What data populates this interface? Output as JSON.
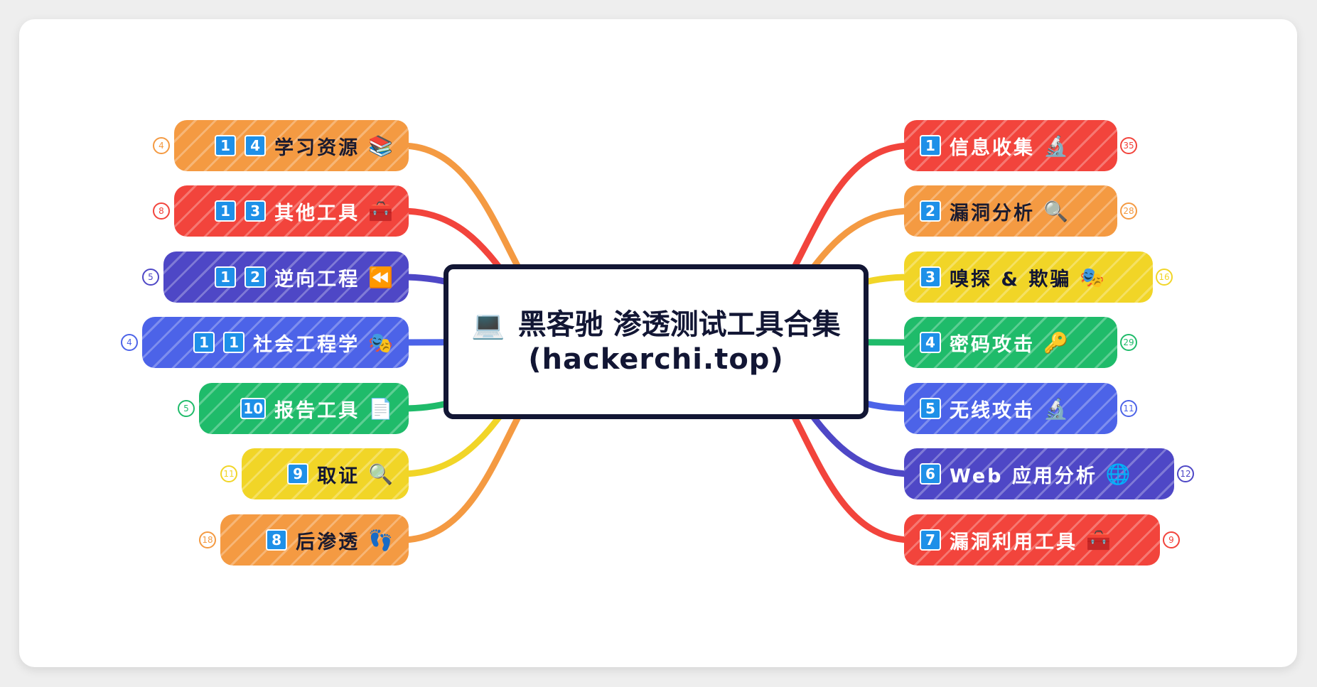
{
  "center": {
    "icon": "💻",
    "title": "黑客驰 渗透测试工具合集",
    "subtitle": "(hackerchi.top)"
  },
  "colors": {
    "red": "#f2443c",
    "orange": "#f49a42",
    "yellow": "#f1d527",
    "green": "#1fbb6a",
    "blue": "#4c63e8",
    "indigo": "#4e47c6",
    "dark": "#121634",
    "badge": "#1e90e8"
  },
  "right_branches": [
    {
      "badges": [
        "1"
      ],
      "label": "信息收集",
      "emoji": "🔬",
      "count": "35",
      "color": "red"
    },
    {
      "badges": [
        "2"
      ],
      "label": "漏洞分析",
      "emoji": "🔍",
      "count": "28",
      "color": "orange"
    },
    {
      "badges": [
        "3"
      ],
      "label": "嗅探 & 欺骗",
      "emoji": "🎭",
      "count": "16",
      "color": "yellow"
    },
    {
      "badges": [
        "4"
      ],
      "label": "密码攻击",
      "emoji": "🔑",
      "count": "29",
      "color": "green"
    },
    {
      "badges": [
        "5"
      ],
      "label": "无线攻击",
      "emoji": "🔬",
      "count": "11",
      "color": "blue"
    },
    {
      "badges": [
        "6"
      ],
      "label": "Web 应用分析",
      "emoji": "🌐",
      "count": "12",
      "color": "indigo"
    },
    {
      "badges": [
        "7"
      ],
      "label": "漏洞利用工具",
      "emoji": "🧰",
      "count": "9",
      "color": "red"
    }
  ],
  "left_branches": [
    {
      "badges": [
        "1",
        "4"
      ],
      "label": "学习资源",
      "emoji": "📚",
      "count": "4",
      "color": "orange"
    },
    {
      "badges": [
        "1",
        "3"
      ],
      "label": "其他工具",
      "emoji": "🧰",
      "count": "8",
      "color": "red"
    },
    {
      "badges": [
        "1",
        "2"
      ],
      "label": "逆向工程",
      "emoji": "⏪",
      "count": "5",
      "color": "indigo"
    },
    {
      "badges": [
        "1",
        "1"
      ],
      "label": "社会工程学",
      "emoji": "🎭",
      "count": "4",
      "color": "blue"
    },
    {
      "badges": [
        "10"
      ],
      "label": "报告工具",
      "emoji": "📄",
      "count": "5",
      "color": "green"
    },
    {
      "badges": [
        "9"
      ],
      "label": "取证",
      "emoji": "🔍",
      "count": "11",
      "color": "yellow"
    },
    {
      "badges": [
        "8"
      ],
      "label": "后渗透",
      "emoji": "👣",
      "count": "18",
      "color": "orange"
    }
  ]
}
